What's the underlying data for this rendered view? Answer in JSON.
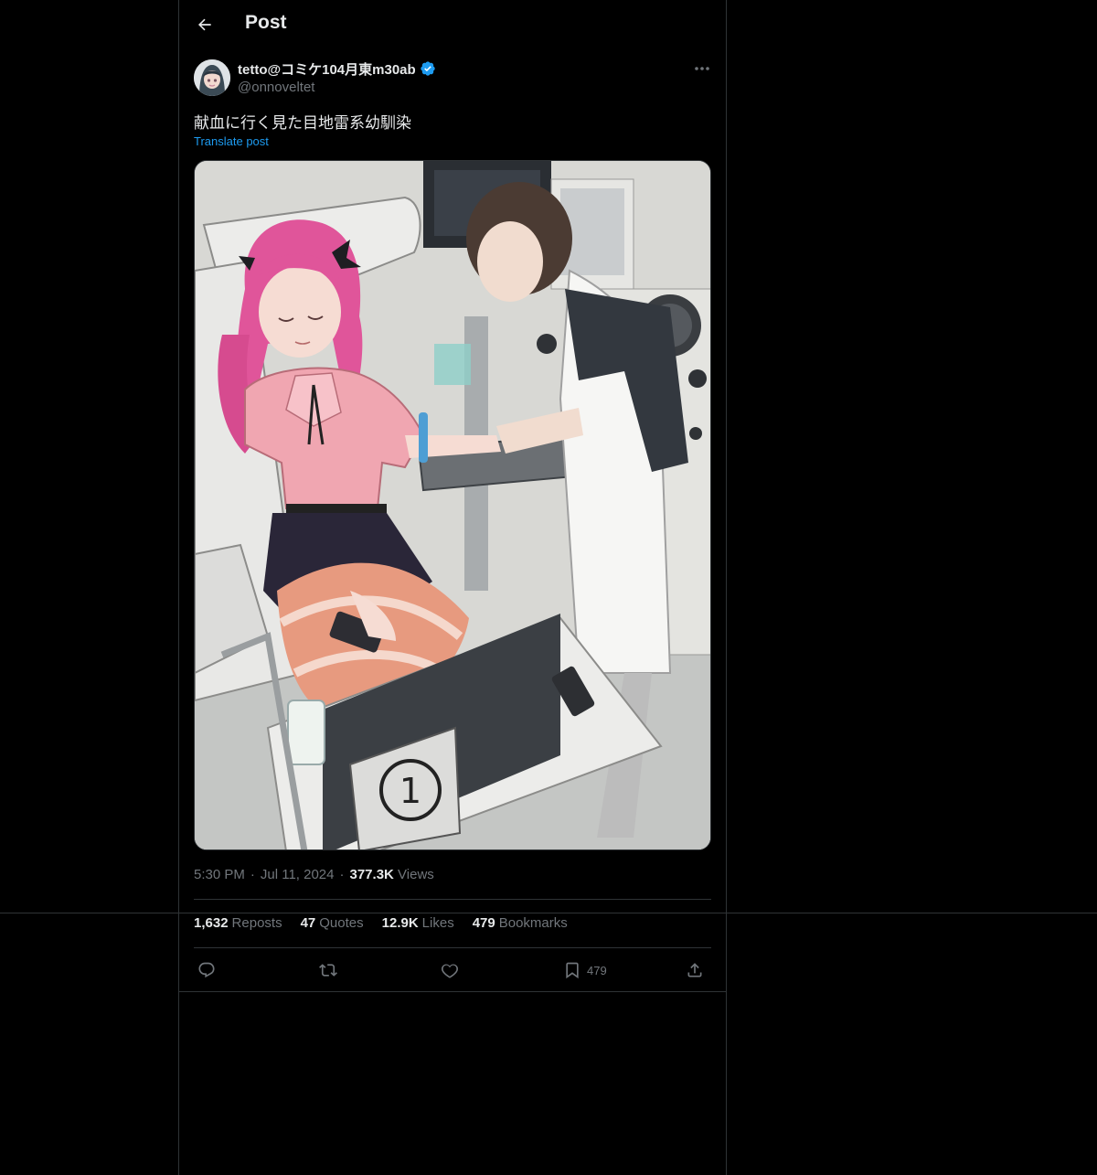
{
  "header": {
    "title": "Post",
    "back_icon": "arrow-left-icon"
  },
  "author": {
    "display_name": "tetto@コミケ104月東m30ab",
    "handle": "@onnoveltet",
    "verified": true,
    "verified_color": "#1d9bf0"
  },
  "post": {
    "text": "献血に行く見た目地雷系幼馴染",
    "translate_label": "Translate post"
  },
  "meta": {
    "time": "5:30 PM",
    "dot": "·",
    "date": "Jul 11, 2024",
    "views_count": "377.3K",
    "views_label": "Views"
  },
  "stats": [
    {
      "count": "1,632",
      "label": "Reposts"
    },
    {
      "count": "47",
      "label": "Quotes"
    },
    {
      "count": "12.9K",
      "label": "Likes"
    },
    {
      "count": "479",
      "label": "Bookmarks"
    }
  ],
  "actions": {
    "reply_icon": "reply-icon",
    "repost_icon": "repost-icon",
    "like_icon": "heart-icon",
    "bookmark_icon": "bookmark-icon",
    "bookmark_count": "479",
    "share_icon": "share-icon"
  },
  "colors": {
    "background": "#000000",
    "text": "#e7e9ea",
    "muted": "#71767b",
    "accent": "#1d9bf0",
    "border": "#2f3336"
  }
}
